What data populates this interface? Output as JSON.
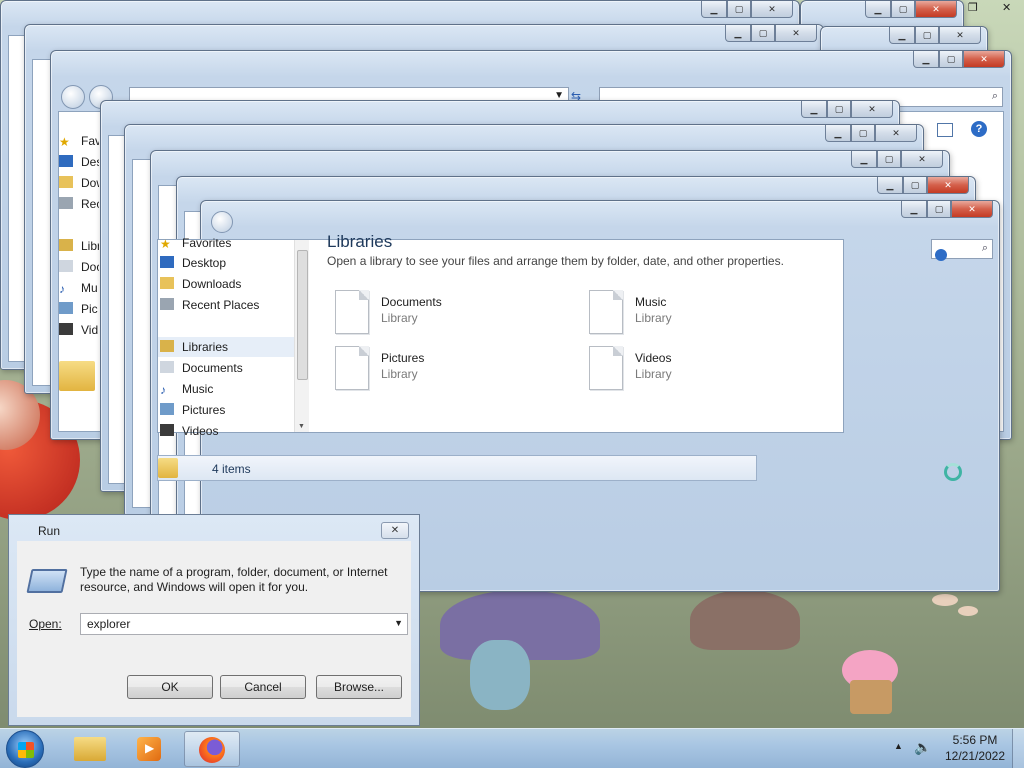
{
  "explorer": {
    "title": "Libraries",
    "subtitle": "Open a library to see your files and arrange them by folder, date, and other properties.",
    "nav": {
      "favorites": "Favorites",
      "favorites_items": [
        "Desktop",
        "Downloads",
        "Recent Places"
      ],
      "libraries": "Libraries",
      "library_items": [
        "Documents",
        "Music",
        "Pictures",
        "Videos"
      ]
    },
    "libraries": [
      {
        "name": "Documents",
        "type": "Library"
      },
      {
        "name": "Music",
        "type": "Library"
      },
      {
        "name": "Pictures",
        "type": "Library"
      },
      {
        "name": "Videos",
        "type": "Library"
      }
    ],
    "status": "4 items",
    "back_nav_items": [
      "Favo",
      "Des",
      "Dow",
      "Rec",
      "Libra",
      "Doc",
      "Mu",
      "Pic",
      "Vid"
    ]
  },
  "run": {
    "title": "Run",
    "prompt": "Type the name of a program, folder, document, or Internet resource, and Windows will open it for you.",
    "open_label": "Open:",
    "open_value": "explorer",
    "ok_label": "OK",
    "cancel_label": "Cancel",
    "browse_label": "Browse..."
  },
  "taskbar": {
    "time": "5:56 PM",
    "date": "12/21/2022"
  },
  "icons": {
    "minimize": "minimize-icon",
    "maximize": "maximize-icon",
    "close": "close-icon",
    "start": "windows-start-icon",
    "folder": "folder-icon",
    "media": "media-player-icon",
    "firefox": "firefox-icon",
    "volume": "speaker-icon",
    "network": "network-icon"
  },
  "colors": {
    "close_button": "#c43b24",
    "window_frame": "#b9cde4",
    "taskbar": "#a9c6e3",
    "link_text": "#1e395b"
  }
}
